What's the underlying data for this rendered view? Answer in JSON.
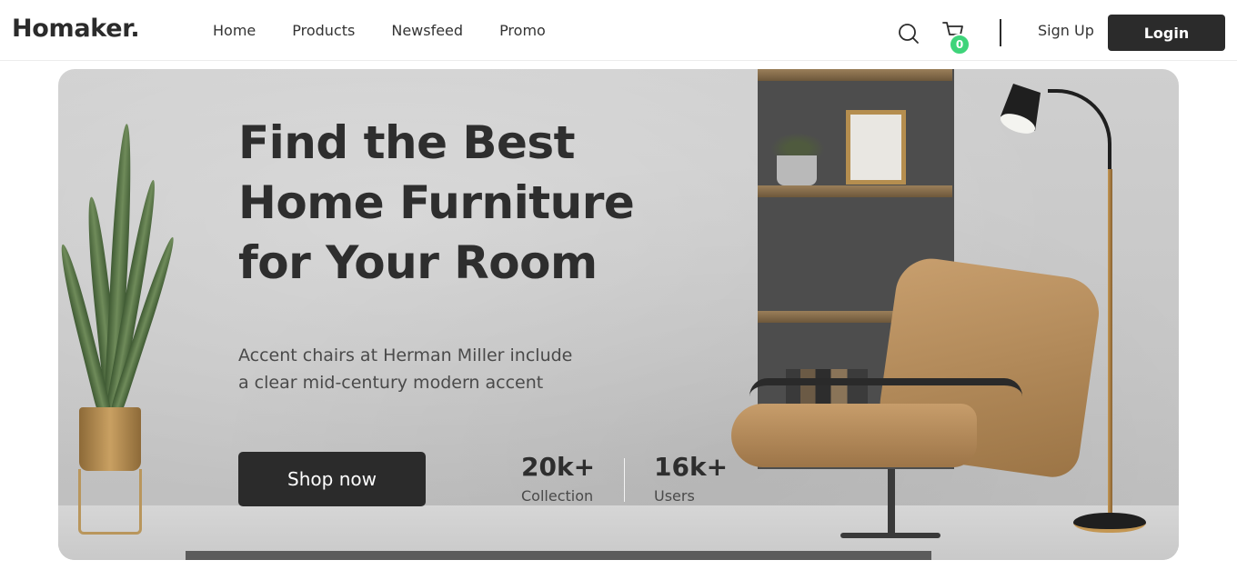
{
  "brand": {
    "logo": "Homaker."
  },
  "nav": {
    "links": [
      "Home",
      "Products",
      "Newsfeed",
      "Promo"
    ],
    "search_icon": "search-icon",
    "cart_icon": "cart-icon",
    "cart_count": "0",
    "signup_label": "Sign Up",
    "login_label": "Login"
  },
  "hero": {
    "title_lines": [
      "Find the Best",
      "Home Furniture",
      "for Your Room"
    ],
    "subtitle_lines": [
      "Accent chairs at Herman Miller include",
      "a clear mid-century modern accent"
    ],
    "cta_label": "Shop now",
    "stats": [
      {
        "value": "20k+",
        "label": "Collection"
      },
      {
        "value": "16k+",
        "label": "Users"
      }
    ]
  },
  "colors": {
    "primary_dark": "#2b2b2b",
    "badge_green": "#3ed47a",
    "hero_bg": "#c9c9c9"
  }
}
